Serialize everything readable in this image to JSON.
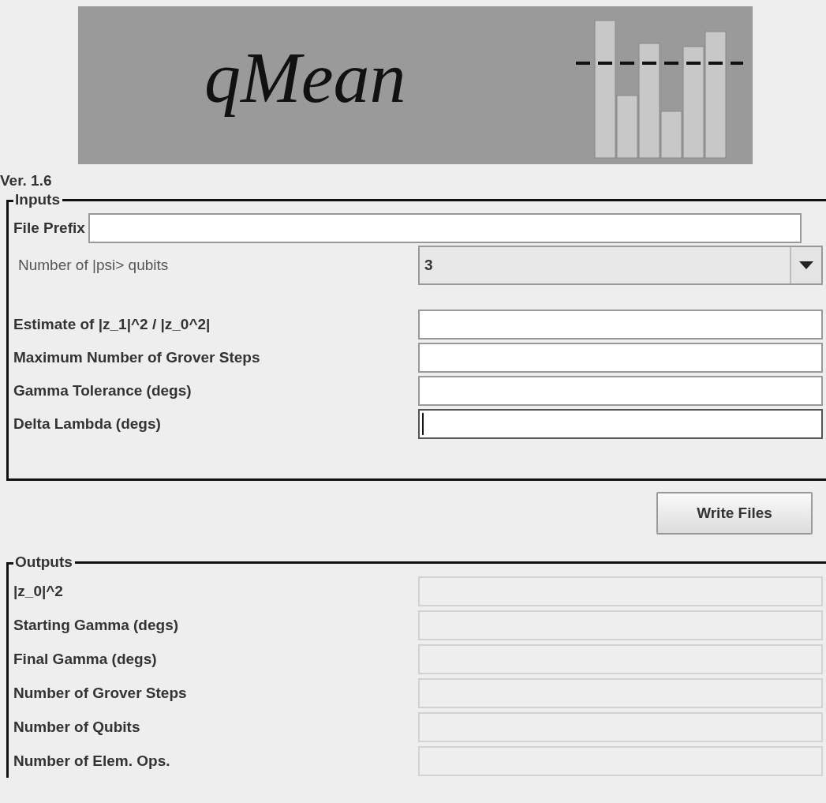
{
  "banner": {
    "title": "qMean"
  },
  "version": "Ver. 1.6",
  "inputs": {
    "title": "Inputs",
    "file_prefix": {
      "label": "File Prefix",
      "focused": false
    },
    "qubits": {
      "label": "Number of |psi> qubits",
      "value": "3"
    },
    "fields": [
      {
        "label": "Estimate of |z_1|^2  /  |z_0^2|",
        "focused": false
      },
      {
        "label": "Maximum Number of Grover Steps",
        "focused": false
      },
      {
        "label": "Gamma Tolerance (degs)",
        "focused": false
      },
      {
        "label": "Delta Lambda (degs)",
        "focused": true
      }
    ]
  },
  "write_button": "Write Files",
  "outputs": {
    "title": "Outputs",
    "rows": [
      {
        "label": "|z_0|^2"
      },
      {
        "label": "Starting Gamma (degs)"
      },
      {
        "label": "Final Gamma (degs)"
      },
      {
        "label": "Number of Grover Steps"
      },
      {
        "label": "Number of Qubits"
      },
      {
        "label": "Number of Elem. Ops."
      }
    ]
  }
}
